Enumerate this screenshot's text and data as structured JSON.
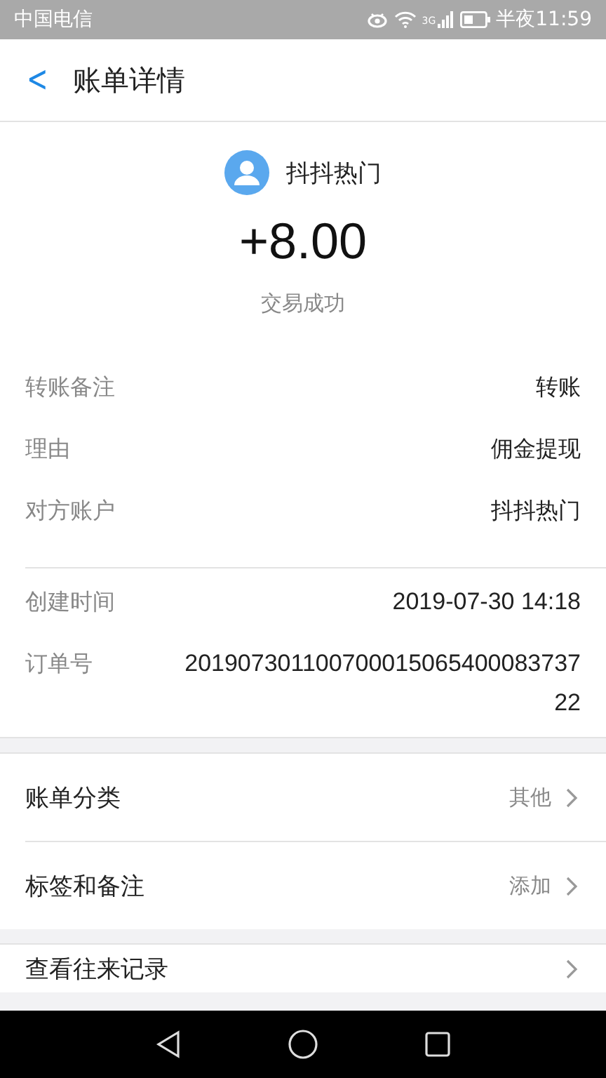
{
  "status_bar": {
    "carrier": "中国电信",
    "network": "3G",
    "time": "半夜11:59"
  },
  "header": {
    "back": "<",
    "title": "账单详情"
  },
  "summary": {
    "name": "抖抖热门",
    "amount": "+8.00",
    "status": "交易成功"
  },
  "details": [
    {
      "label": "转账备注",
      "value": "转账"
    },
    {
      "label": "理由",
      "value": "佣金提现"
    },
    {
      "label": "对方账户",
      "value": "抖抖热门"
    }
  ],
  "details_2": [
    {
      "label": "创建时间",
      "value": "2019-07-30 14:18"
    },
    {
      "label": "订单号",
      "value": "201907301100700015065400083737 22"
    }
  ],
  "actions": [
    {
      "label": "账单分类",
      "value": "其他"
    },
    {
      "label": "标签和备注",
      "value": "添加"
    }
  ],
  "actions_2": [
    {
      "label": "查看往来记录"
    }
  ]
}
